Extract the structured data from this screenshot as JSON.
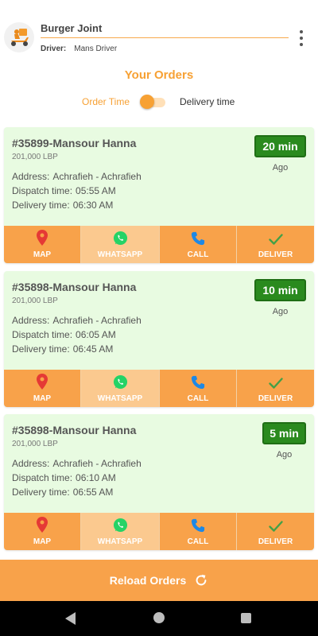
{
  "header": {
    "store_name": "Burger Joint",
    "driver_label": "Driver:",
    "driver_name": "Mans Driver",
    "logo_icon": "scooter-delivery-icon",
    "menu_icon": "more-vertical-icon"
  },
  "page_title": "Your Orders",
  "sort_toggle": {
    "left_label": "Order Time",
    "right_label": "Delivery time",
    "selected": "Order Time"
  },
  "labels": {
    "address": "Address:",
    "dispatch": "Dispatch time:",
    "delivery": "Delivery time:",
    "ago": "Ago"
  },
  "actions": {
    "map": "MAP",
    "whatsapp": "WHATSAPP",
    "call": "CALL",
    "deliver": "DELIVER"
  },
  "orders": [
    {
      "title": "#35899-Mansour Hanna",
      "price": "201,000 LBP",
      "address": "Achrafieh - Achrafieh",
      "dispatch_time": "05:55 AM",
      "delivery_time": "06:30 AM",
      "elapsed": "20 min"
    },
    {
      "title": "#35898-Mansour Hanna",
      "price": "201,000 LBP",
      "address": "Achrafieh - Achrafieh",
      "dispatch_time": "06:05 AM",
      "delivery_time": "06:45 AM",
      "elapsed": "10 min"
    },
    {
      "title": "#35898-Mansour Hanna",
      "price": "201,000 LBP",
      "address": "Achrafieh - Achrafieh",
      "dispatch_time": "06:10 AM",
      "delivery_time": "06:55 AM",
      "elapsed": "5 min"
    }
  ],
  "reload_button": "Reload Orders",
  "colors": {
    "accent": "#f7a134",
    "card_bg": "#e8fbe1",
    "badge_green": "#2a8a1e",
    "action_bar": "#f8a24a",
    "map_pin": "#e53935",
    "whatsapp": "#25d366",
    "call": "#1e88e5",
    "deliver": "#43a047"
  }
}
